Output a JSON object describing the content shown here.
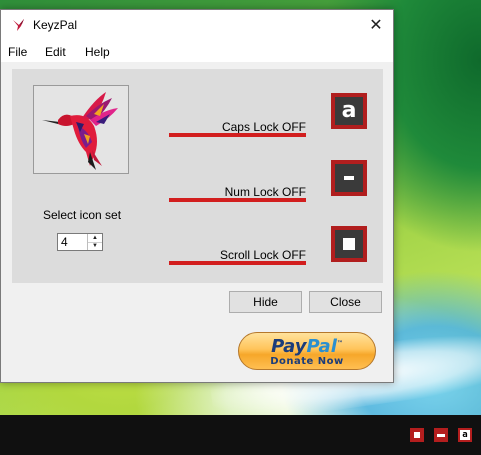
{
  "window": {
    "title": "KeyzPal",
    "close_glyph": "✕"
  },
  "menu": [
    "File",
    "Edit",
    "Help"
  ],
  "icon_set": {
    "label": "Select icon set",
    "value": "4"
  },
  "locks": [
    {
      "label": "Caps Lock OFF",
      "indicator": "a"
    },
    {
      "label": "Num Lock OFF",
      "indicator": "-"
    },
    {
      "label": "Scroll Lock OFF",
      "indicator": "square"
    }
  ],
  "buttons": {
    "hide": "Hide",
    "close": "Close"
  },
  "paypal": {
    "pay": "Pay",
    "pal": "Pal",
    "tm": "™",
    "donate": "Donate Now"
  },
  "tray": {
    "scroll_glyph": "▪",
    "num_glyph": "-",
    "caps_glyph": "a"
  },
  "colors": {
    "accent_red": "#d21e1e",
    "indicator_red": "#b11e1e",
    "indicator_dark": "#3a3a3a",
    "paypal_gold": "#ffc45a",
    "paypal_navy": "#1b3d7b"
  },
  "icons": {
    "app": "hummingbird-icon",
    "close": "close-icon",
    "spin_up": "chevron-up-icon",
    "spin_down": "chevron-down-icon"
  }
}
